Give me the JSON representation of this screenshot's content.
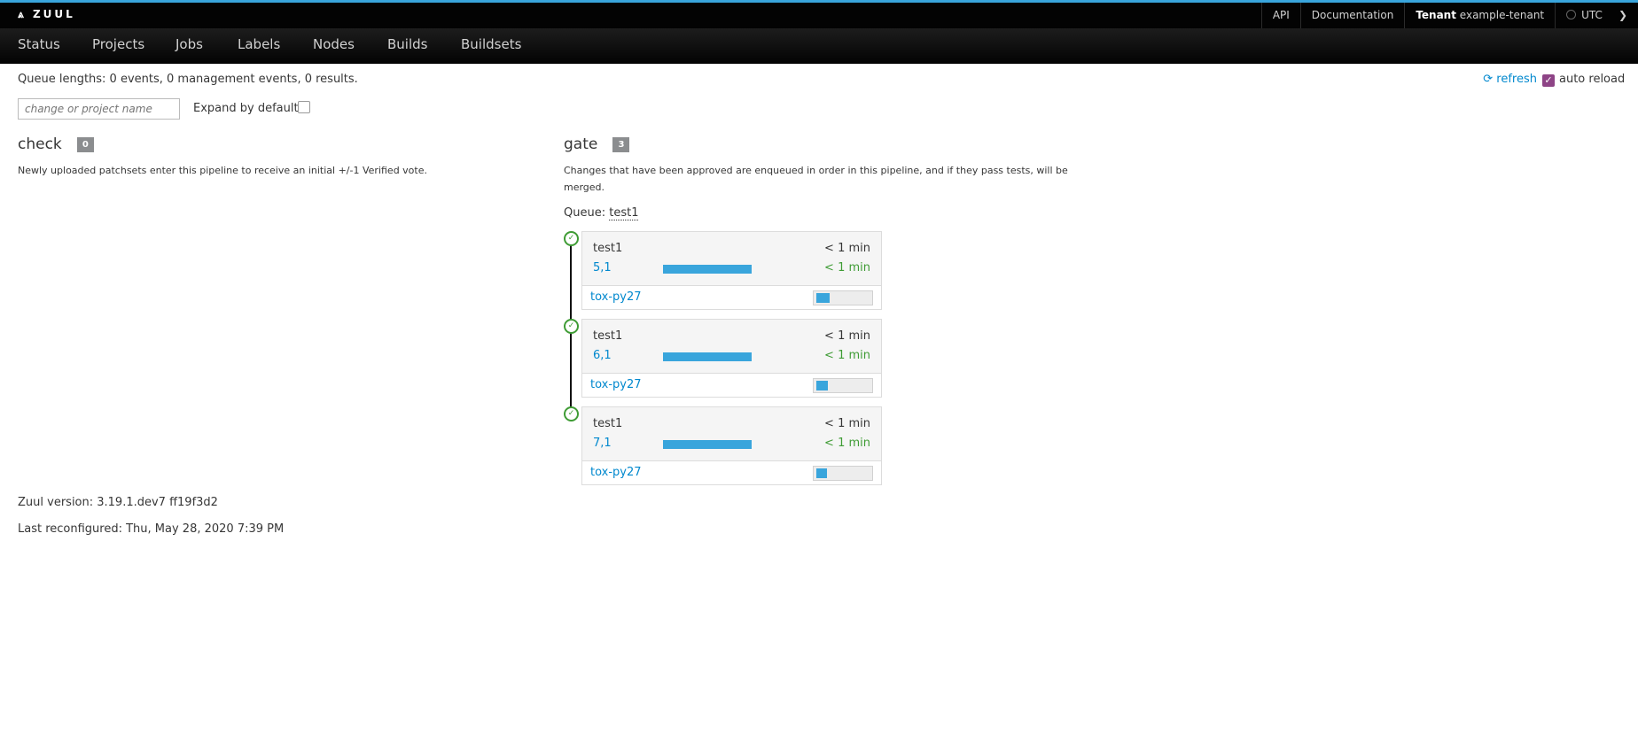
{
  "header": {
    "brand": "ZUUL",
    "api": "API",
    "documentation": "Documentation",
    "tenant_label": "Tenant",
    "tenant_name": "example-tenant",
    "timezone": "UTC"
  },
  "nav": [
    "Status",
    "Projects",
    "Jobs",
    "Labels",
    "Nodes",
    "Builds",
    "Buildsets"
  ],
  "toolbar": {
    "queue_lengths": "Queue lengths: 0 events, 0 management events, 0 results.",
    "refresh": "refresh",
    "auto_reload": "auto reload",
    "auto_reload_checked": true,
    "filter_placeholder": "change or project name",
    "expand_label": "Expand by default:",
    "expand_checked": false
  },
  "pipelines": [
    {
      "name": "check",
      "count": "0",
      "description": "Newly uploaded patchsets enter this pipeline to receive an initial +/-1 Verified vote."
    },
    {
      "name": "gate",
      "count": "3",
      "description_line1": "Changes that have been approved are enqueued in order in this pipeline, and if they pass tests, will be",
      "description_line2": "merged.",
      "queue_label": "Queue:",
      "queue_name": "test1",
      "changes": [
        {
          "project": "test1",
          "change": "5,1",
          "enqueue_time": "< 1 min",
          "remaining": "< 1 min",
          "progress": 1.0,
          "job": "tox-py27",
          "job_progress": 0.25,
          "status_icon": "check-circle-icon"
        },
        {
          "project": "test1",
          "change": "6,1",
          "enqueue_time": "< 1 min",
          "remaining": "< 1 min",
          "progress": 1.0,
          "job": "tox-py27",
          "job_progress": 0.22,
          "status_icon": "check-circle-icon"
        },
        {
          "project": "test1",
          "change": "7,1",
          "enqueue_time": "< 1 min",
          "remaining": "< 1 min",
          "progress": 1.0,
          "job": "tox-py27",
          "job_progress": 0.2,
          "status_icon": "check-circle-icon"
        }
      ]
    }
  ],
  "footer": {
    "version": "Zuul version: 3.19.1.dev7 ff19f3d2",
    "reconfigured": "Last reconfigured: Thu, May 28, 2020 7:39 PM"
  },
  "colors": {
    "accent": "#39a5dc",
    "link": "#0088ce",
    "success": "#3f9c35",
    "auto_reload_check": "#8e4486"
  }
}
